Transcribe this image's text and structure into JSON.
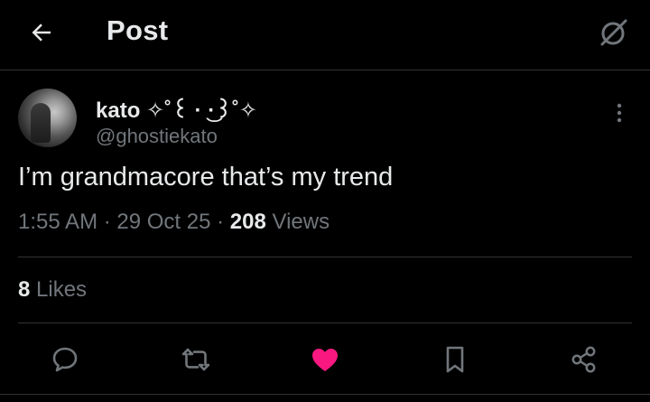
{
  "header": {
    "title": "Post",
    "back_icon": "arrow-left-icon",
    "grok_icon": "grok-slash-circle-icon"
  },
  "post": {
    "author": {
      "display_name": "kato ✧˚꒰ · ͜·꒱˚✧",
      "handle": "@ghostiekato"
    },
    "text": "I’m grandmacore that’s my trend",
    "time": "1:55 AM",
    "date": "29 Oct 25",
    "views_count": "208",
    "views_label": " Views",
    "likes_count": "8",
    "likes_label": " Likes"
  },
  "actions": [
    {
      "name": "reply",
      "icon": "speech-bubble-icon"
    },
    {
      "name": "repost",
      "icon": "repost-arrows-icon"
    },
    {
      "name": "like",
      "icon": "heart-icon",
      "active": true
    },
    {
      "name": "bookmark",
      "icon": "bookmark-icon"
    },
    {
      "name": "share",
      "icon": "share-nodes-icon"
    }
  ],
  "colors": {
    "background": "#000000",
    "text_primary": "#e7e9ea",
    "text_secondary": "#71767b",
    "divider": "#2f3336",
    "like_active": "#f91880"
  }
}
